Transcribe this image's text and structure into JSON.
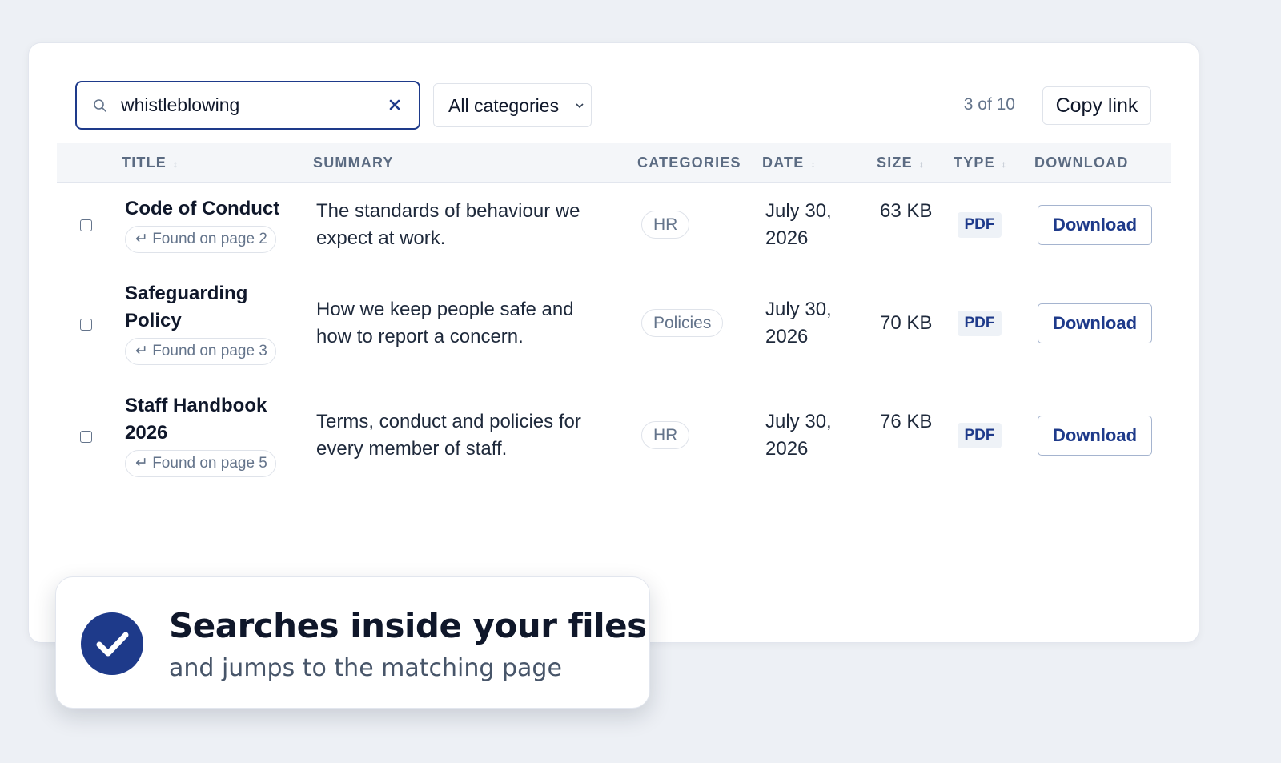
{
  "search": {
    "value": "whistleblowing",
    "clear_icon": "close-icon",
    "search_icon": "search-icon"
  },
  "filter": {
    "selected": "All categories",
    "icon": "chevron-down-icon"
  },
  "results": {
    "counter": "3 of 10",
    "copy_link": "Copy link"
  },
  "table": {
    "headers": {
      "title": "TITLE",
      "summary": "SUMMARY",
      "categories": "CATEGORIES",
      "date": "DATE",
      "size": "SIZE",
      "type": "TYPE",
      "download": "DOWNLOAD"
    },
    "rows": [
      {
        "title": "Code of Conduct",
        "found": "↵ Found on page 2",
        "summary": "The standards of behaviour we expect at work.",
        "category": "HR",
        "date": "July 30, 2026",
        "size": "63 KB",
        "type": "PDF",
        "download": "Download"
      },
      {
        "title": "Safeguarding Policy",
        "found": "↵ Found on page 3",
        "summary": "How we keep people safe and how to report a concern.",
        "category": "Policies",
        "date": "July 30, 2026",
        "size": "70 KB",
        "type": "PDF",
        "download": "Download"
      },
      {
        "title": "Staff Handbook 2026",
        "found": "↵ Found on page 5",
        "summary": "Terms, conduct and policies for every member of staff.",
        "category": "HR",
        "date": "July 30, 2026",
        "size": "76 KB",
        "type": "PDF",
        "download": "Download"
      }
    ]
  },
  "toast": {
    "title": "Searches inside your files",
    "subtitle": "and jumps to the matching page",
    "icon": "check-circle-icon"
  },
  "colors": {
    "accent": "#1e3a8a",
    "background": "#edf0f5"
  }
}
